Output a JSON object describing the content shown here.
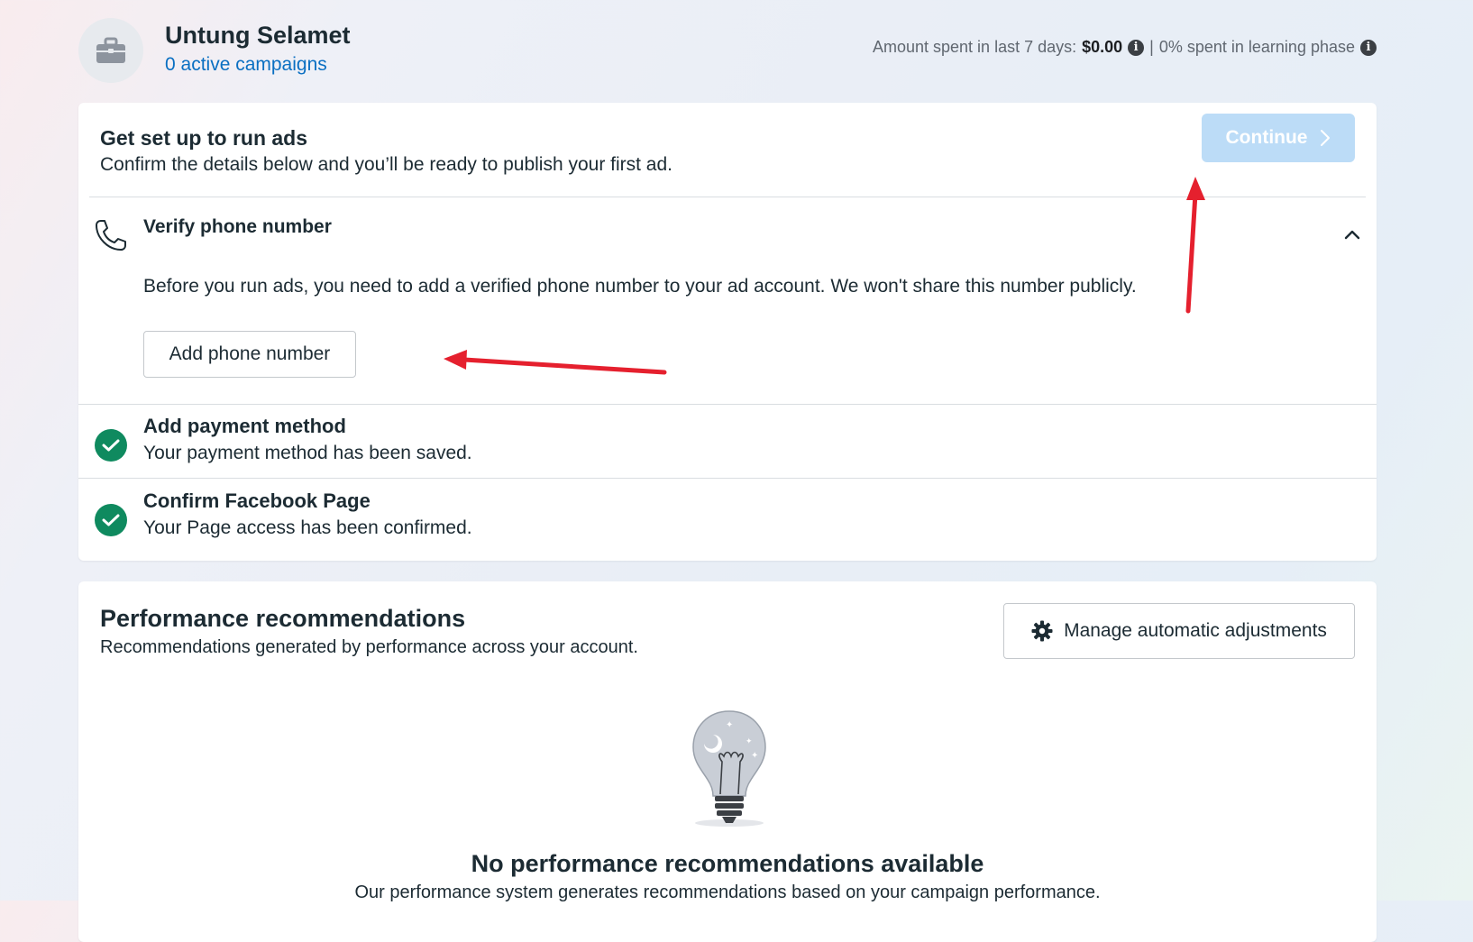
{
  "header": {
    "account_name": "Untung Selamet",
    "active_campaigns": "0 active campaigns",
    "spend_label": "Amount spent in last 7 days:",
    "spend_amount": "$0.00",
    "separator": "|",
    "learning_phase": "0% spent in learning phase",
    "icon": "briefcase-icon"
  },
  "setup": {
    "title": "Get set up to run ads",
    "subtitle": "Confirm the details below and you’ll be ready to publish your first ad.",
    "continue_label": "Continue",
    "verify_phone": {
      "title": "Verify phone number",
      "description": "Before you run ads, you need to add a verified phone number to your ad account. We won't share this number publicly.",
      "button_label": "Add phone number",
      "icon": "phone-icon",
      "expanded": true
    },
    "payment": {
      "title": "Add payment method",
      "description": "Your payment method has been saved.",
      "status": "complete"
    },
    "page": {
      "title": "Confirm Facebook Page",
      "description": "Your Page access has been confirmed.",
      "status": "complete"
    }
  },
  "performance": {
    "title": "Performance recommendations",
    "subtitle": "Recommendations generated by performance across your account.",
    "manage_label": "Manage automatic adjustments",
    "empty_title": "No performance recommendations available",
    "empty_description": "Our performance system generates recommendations based on your campaign performance."
  },
  "colors": {
    "link": "#0a6fc2",
    "continue_disabled": "#bcdcf7",
    "success": "#0f8a5f",
    "annotation_arrow": "#e5202e"
  }
}
